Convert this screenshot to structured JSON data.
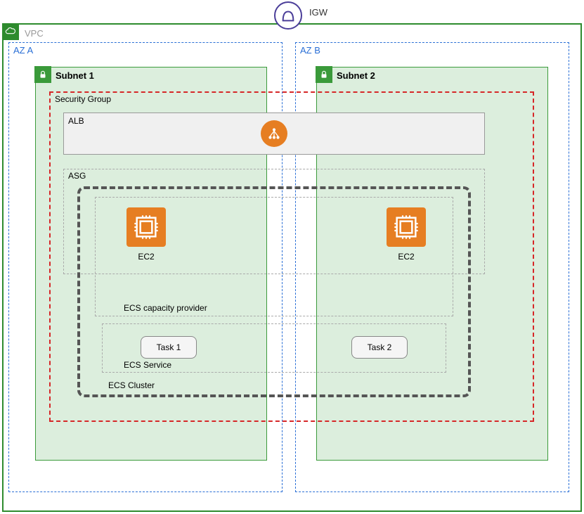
{
  "igw": {
    "label": "IGW"
  },
  "vpc": {
    "label": "VPC"
  },
  "az_a": {
    "label": "AZ A"
  },
  "az_b": {
    "label": "AZ B"
  },
  "subnet1": {
    "label": "Subnet 1"
  },
  "subnet2": {
    "label": "Subnet 2"
  },
  "security_group": {
    "label": "Security Group"
  },
  "alb": {
    "label": "ALB"
  },
  "asg": {
    "label": "ASG"
  },
  "ecs_cluster": {
    "label": "ECS Cluster"
  },
  "ecs_capacity_provider": {
    "label": "ECS capacity provider"
  },
  "ecs_service": {
    "label": "ECS Service"
  },
  "ec2_1": {
    "label": "EC2"
  },
  "ec2_2": {
    "label": "EC2"
  },
  "task1": {
    "label": "Task 1"
  },
  "task2": {
    "label": "Task 2"
  }
}
